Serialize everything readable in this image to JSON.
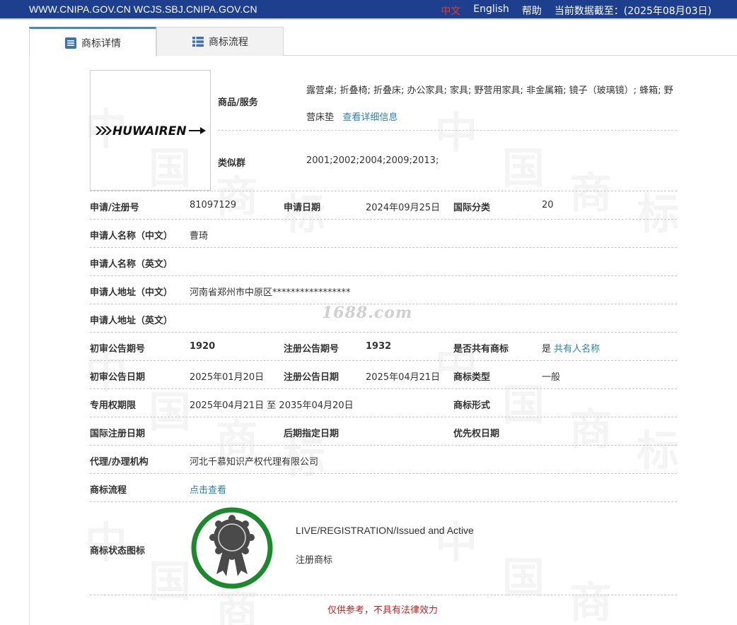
{
  "topbar": {
    "sites": "WWW.CNIPA.GOV.CN WCJS.SBJ.CNIPA.GOV.CN",
    "lang_zh": "中文",
    "lang_en": "English",
    "help": "帮助",
    "data_date": "当前数据截至：(2025年08月03日)"
  },
  "tabs": [
    {
      "label": "商标详情",
      "icon": "document-list-icon",
      "active": true
    },
    {
      "label": "商标流程",
      "icon": "list-icon",
      "active": false
    }
  ],
  "logo": {
    "text": "HUWAIREN"
  },
  "goods": {
    "label": "商品/服务",
    "value": "露营桌; 折叠椅; 折叠床; 办公家具; 家具; 野营用家具; 非金属箱; 镜子（玻璃镜）; 蜂箱; 野营床垫",
    "more_link": "查看详细信息"
  },
  "similar_group": {
    "label": "类似群",
    "value": "2001;2002;2004;2009;2013;"
  },
  "fields": {
    "reg_no_label": "申请/注册号",
    "reg_no": "81097129",
    "apply_date_label": "申请日期",
    "apply_date": "2024年09月25日",
    "intl_class_label": "国际分类",
    "intl_class": "20",
    "applicant_cn_label": "申请人名称（中文）",
    "applicant_cn": "曹琦",
    "applicant_en_label": "申请人名称（英文）",
    "applicant_en": "",
    "address_cn_label": "申请人地址（中文）",
    "address_cn": "河南省郑州市中原区*****************",
    "address_en_label": "申请人地址（英文）",
    "address_en": "",
    "prelim_no_label": "初审公告期号",
    "prelim_no": "1920",
    "reg_pub_no_label": "注册公告期号",
    "reg_pub_no": "1932",
    "shared_label": "是否共有商标",
    "shared": "是",
    "shared_link": "共有人名称",
    "prelim_date_label": "初审公告日期",
    "prelim_date": "2025年01月20日",
    "reg_pub_date_label": "注册公告日期",
    "reg_pub_date": "2025年04月21日",
    "tm_type_label": "商标类型",
    "tm_type": "一般",
    "exclusive_label": "专用权期限",
    "exclusive": "2025年04月21日 至 2035年04月20日",
    "tm_form_label": "商标形式",
    "tm_form": "",
    "intl_reg_date_label": "国际注册日期",
    "intl_reg_date": "",
    "later_date_label": "后期指定日期",
    "later_date": "",
    "priority_date_label": "优先权日期",
    "priority_date": "",
    "agent_label": "代理/办理机构",
    "agent": "河北千慕知识产权代理有限公司",
    "flow_label": "商标流程",
    "flow_link": "点击查看",
    "status_label": "商标状态图标",
    "status_en": "LIVE/REGISTRATION/Issued and Active",
    "status_cn": "注册商标"
  },
  "watermark_site": "1688.com",
  "watermark_chars": [
    "中",
    "国",
    "商",
    "标"
  ],
  "disclaimer": "仅供参考，不具有法律效力",
  "colors": {
    "topbar": "#1d3f8e",
    "link": "#2a82b4",
    "badge_ring": "#1a8a2c",
    "disclaimer": "#c0211e"
  }
}
